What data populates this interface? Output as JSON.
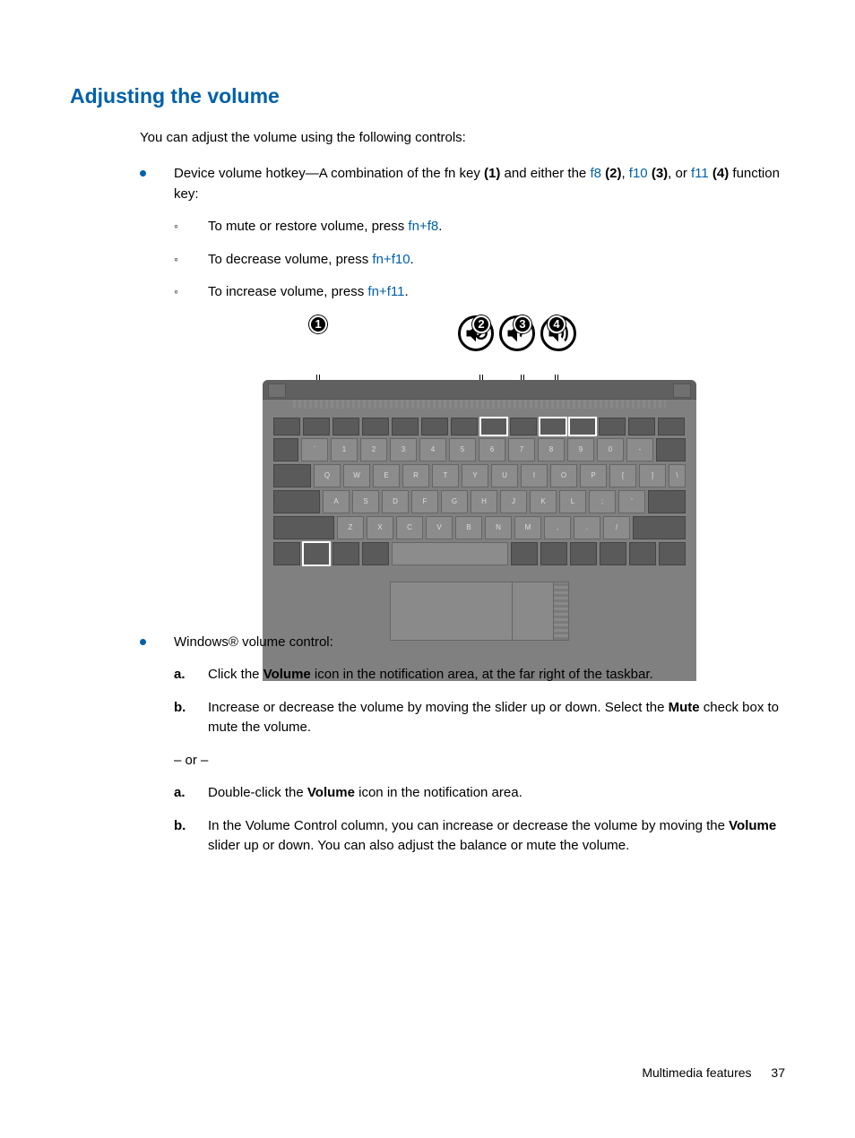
{
  "heading": "Adjusting the volume",
  "intro": "You can adjust the volume using the following controls:",
  "bullet1": {
    "prefix": "Device volume hotkey—A combination of the fn key ",
    "one": "(1)",
    "mid1": " and either the ",
    "f8": "f8",
    "two": " (2)",
    "sep1": ", ",
    "f10": "f10",
    "three": " (3)",
    "sep2": ", or ",
    "f11": "f11",
    "four": " (4)",
    "suffix": " function key:"
  },
  "sub": {
    "mute_pre": "To mute or restore volume, press ",
    "mute_key": "fn+f8",
    "mute_post": ".",
    "dec_pre": "To decrease volume, press ",
    "dec_key": "fn+f10",
    "dec_post": ".",
    "inc_pre": "To increase volume, press ",
    "inc_key": "fn+f11",
    "inc_post": "."
  },
  "bullet2_label": "Windows® volume control:",
  "steps1": {
    "a_pre": "Click the ",
    "a_bold": "Volume",
    "a_post": " icon in the notification area, at the far right of the taskbar.",
    "b_pre": "Increase or decrease the volume by moving the slider up or down. Select the ",
    "b_bold": "Mute",
    "b_post": " check box to mute the volume."
  },
  "or": "– or –",
  "steps2": {
    "a_pre": "Double-click the ",
    "a_bold": "Volume",
    "a_post": " icon in the notification area.",
    "b_pre": "In the Volume Control column, you can increase or decrease the volume by moving the ",
    "b_bold": "Volume",
    "b_post": " slider up or down. You can also adjust the balance or mute the volume."
  },
  "callouts": {
    "c1": "1",
    "c2": "2",
    "c3": "3",
    "c4": "4"
  },
  "keys": {
    "row2": [
      "`",
      "1",
      "2",
      "3",
      "4",
      "5",
      "6",
      "7",
      "8",
      "9",
      "0",
      "-",
      "="
    ],
    "row3": [
      "Q",
      "W",
      "E",
      "R",
      "T",
      "Y",
      "U",
      "I",
      "O",
      "P",
      "[",
      "]",
      "\\"
    ],
    "row4": [
      "A",
      "S",
      "D",
      "F",
      "G",
      "H",
      "J",
      "K",
      "L",
      ";",
      "'"
    ],
    "row5": [
      "Z",
      "X",
      "C",
      "V",
      "B",
      "N",
      "M",
      ",",
      ".",
      "/"
    ]
  },
  "footer_label": "Multimedia features",
  "footer_page": "37"
}
